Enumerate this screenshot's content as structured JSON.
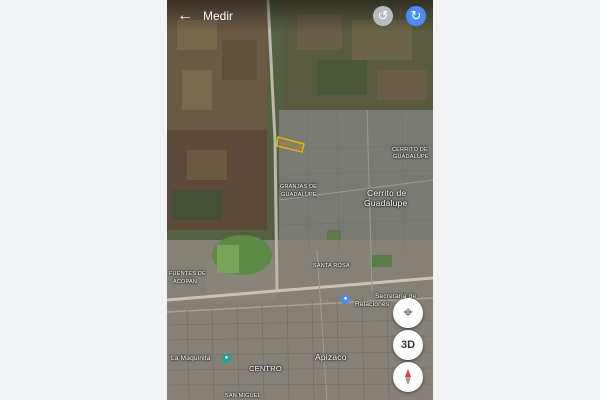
{
  "app": {
    "title": "Medir",
    "back_icon": "arrow-back-icon",
    "undo_icon": "undo-icon",
    "redo_icon": "redo-icon"
  },
  "map": {
    "type": "satellite",
    "labels": {
      "cerrito_small": "CERRITO DE",
      "guadalupe_small": "GUADALUPE",
      "granjas_1": "GRANJAS DE",
      "granjas_2": "GUADALUPE",
      "cerrito_1": "Cerrito de",
      "cerrito_2": "Guadalupe",
      "fuentes_1": "FUENTES DE",
      "fuentes_2": "ACOPAN",
      "santa_rosa": "SANTA ROSA",
      "secretaria_1": "Secretaria de",
      "secretaria_2": "Relaciones",
      "maquinita": "La Maquinita",
      "centro": "CENTRO",
      "apizaco": "Apizaco",
      "san_miguel": "SAN MIGUEL"
    },
    "measured_area_color": "#f4b400"
  },
  "controls": {
    "locate_icon": "my-location-icon",
    "three_d_label": "3D",
    "compass_icon": "compass-icon"
  }
}
